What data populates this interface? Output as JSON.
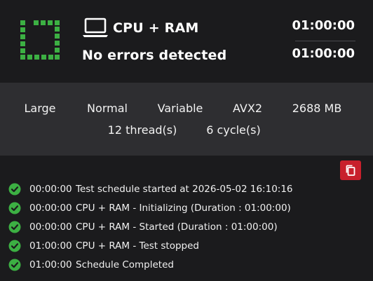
{
  "colors": {
    "background": "#1b1b1d",
    "panel": "#2e2e31",
    "accent_green": "#3cb043",
    "accent_red": "#c8202c",
    "text": "#ffffff"
  },
  "header": {
    "status_icon": "progress-ring-icon",
    "test_icon": "laptop-icon",
    "test_name": "CPU + RAM",
    "status": "No errors detected",
    "time_elapsed": "01:00:00",
    "time_total": "01:00:00"
  },
  "params": {
    "size": "Large",
    "mode": "Normal",
    "pattern": "Variable",
    "instruction_set": "AVX2",
    "memory": "2688 MB",
    "threads": "12 thread(s)",
    "cycles": "6 cycle(s)"
  },
  "actions": {
    "copy_icon": "copy-icon"
  },
  "log": [
    {
      "time": "00:00:00",
      "message": "Test schedule started at 2026-05-02 16:10:16",
      "icon": "check-circle-icon"
    },
    {
      "time": "00:00:00",
      "message": "CPU + RAM - Initializing (Duration : 01:00:00)",
      "icon": "check-circle-icon"
    },
    {
      "time": "00:00:00",
      "message": "CPU + RAM - Started (Duration : 01:00:00)",
      "icon": "check-circle-icon"
    },
    {
      "time": "01:00:00",
      "message": "CPU + RAM - Test stopped",
      "icon": "check-circle-icon"
    },
    {
      "time": "01:00:00",
      "message": "Schedule Completed",
      "icon": "check-circle-icon"
    }
  ]
}
